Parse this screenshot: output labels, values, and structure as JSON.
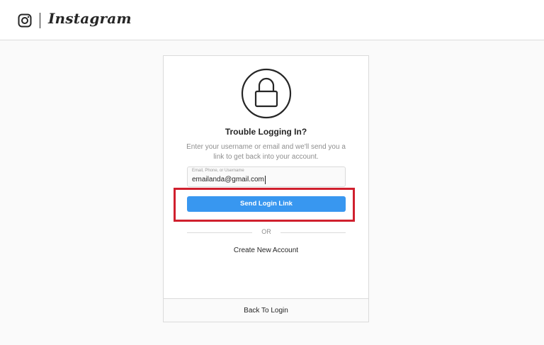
{
  "header": {
    "logo_icon": "instagram-glyph-icon",
    "wordmark": "Instagram"
  },
  "card": {
    "lock_icon": "lock-icon",
    "title": "Trouble Logging In?",
    "description": "Enter your username or email and we'll send you a link to get back into your account.",
    "field": {
      "label": "Email, Phone, or Username",
      "value": "emailanda@gmail.com"
    },
    "send_button": "Send Login Link",
    "or_text": "OR",
    "create_link": "Create New Account",
    "back_link": "Back To Login"
  },
  "colors": {
    "accent": "#3897f0",
    "highlight": "#d0202e",
    "border": "#dbdbdb",
    "background": "#fafafa"
  }
}
